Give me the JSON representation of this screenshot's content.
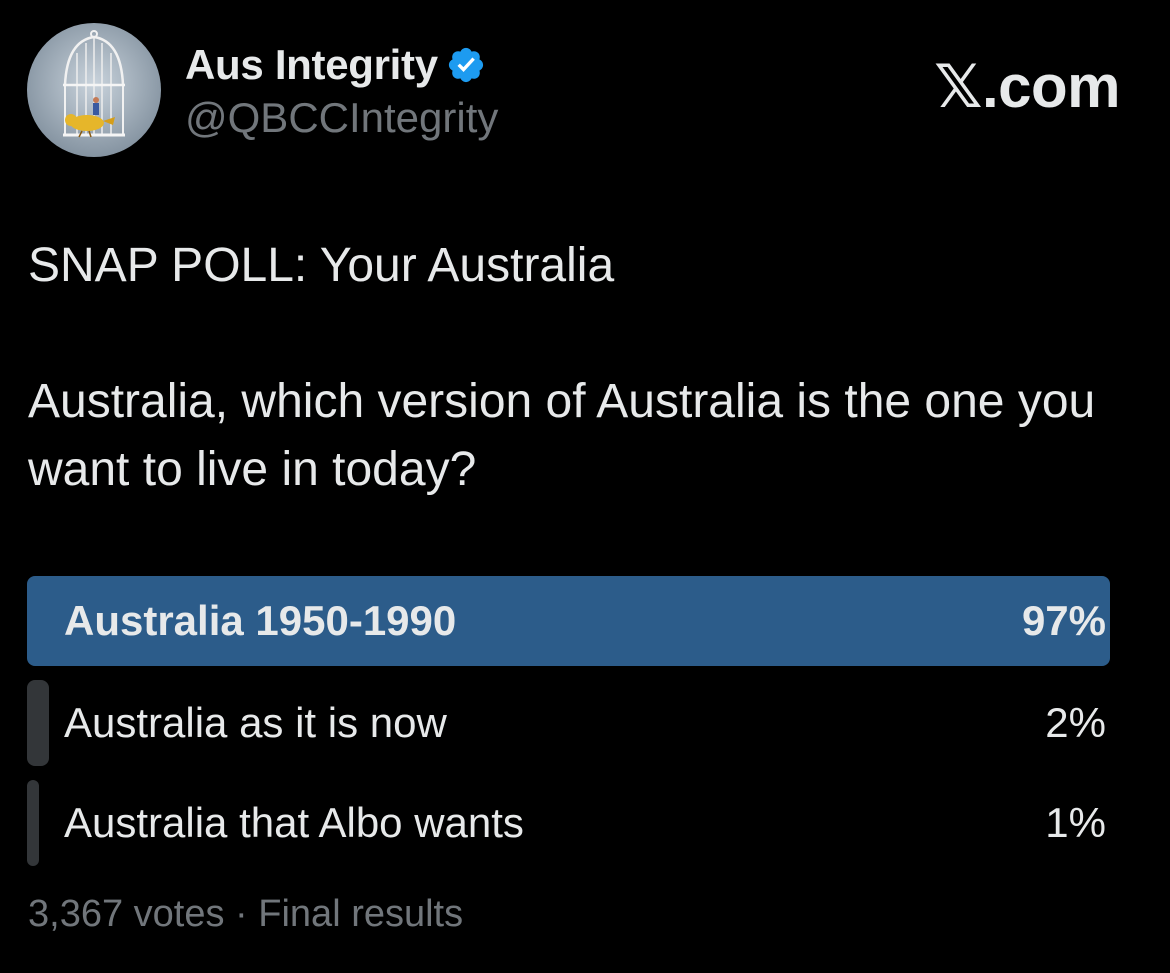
{
  "author": {
    "display_name": "Aus Integrity",
    "handle": "@QBCCIntegrity",
    "verified": true,
    "verified_icon": "verified-badge-icon",
    "avatar_icon": "birdcage-avatar"
  },
  "brand": {
    "label": "𝕏.com"
  },
  "tweet": {
    "headline": "SNAP POLL: Your Australia",
    "question": "Australia, which version of Australia is the one you want to live in today?"
  },
  "poll": {
    "options": [
      {
        "label": "Australia 1950-1990",
        "percent_label": "97%",
        "percent": 97,
        "winner": true
      },
      {
        "label": "Australia as it is now",
        "percent_label": "2%",
        "percent": 2,
        "winner": false
      },
      {
        "label": "Australia that Albo wants",
        "percent_label": "1%",
        "percent": 1,
        "winner": false
      }
    ],
    "votes": "3,367 votes",
    "separator": "·",
    "status": "Final results"
  },
  "colors": {
    "background": "#000000",
    "text": "#e7e9ea",
    "secondary_text": "#71767b",
    "winner_bar": "#2c5c8a",
    "loser_bar": "#333639",
    "verified": "#1d9bf0"
  }
}
